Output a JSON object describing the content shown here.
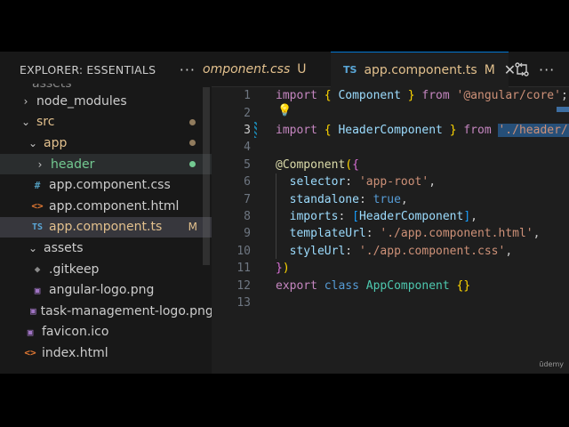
{
  "sidebar": {
    "title": "EXPLORER: ESSENTIALS",
    "more_icon": "ellipsis-icon",
    "cut_item": "assets",
    "items": [
      {
        "label": "node_modules"
      },
      {
        "label": "src"
      },
      {
        "label": "app"
      },
      {
        "label": "header"
      },
      {
        "label": "app.component.css",
        "icon": "#"
      },
      {
        "label": "app.component.html",
        "icon": "<>"
      },
      {
        "label": "app.component.ts",
        "icon": "TS",
        "badge": "M"
      },
      {
        "label": "assets"
      },
      {
        "label": ".gitkeep"
      },
      {
        "label": "angular-logo.png"
      },
      {
        "label": "task-management-logo.png"
      },
      {
        "label": "favicon.ico"
      },
      {
        "label": "index.html",
        "icon": "<>"
      }
    ]
  },
  "tabs": [
    {
      "label": "omponent.css",
      "status": "U"
    },
    {
      "label": "app.component.ts",
      "icon": "TS",
      "status": "M",
      "close": "✕"
    }
  ],
  "editor": {
    "lines": [
      [
        "1",
        "2",
        "3",
        "4",
        "5",
        "6",
        "7",
        "8",
        "9",
        "10",
        "11",
        "12",
        "13"
      ]
    ],
    "tokens": {
      "import": "import",
      "from": "from",
      "export": "export",
      "class": "class",
      "component": "Component",
      "core": "'@angular/core'",
      "header_component": "HeaderComponent",
      "header_path": "'./header/h",
      "decorator": "@Component",
      "selector_key": "selector",
      "selector_val": "'app-root'",
      "standalone_key": "standalone",
      "standalone_val": "true",
      "imports_key": "imports",
      "template_key": "templateUrl",
      "template_val": "'./app.component.html'",
      "style_key": "styleUrl",
      "style_val": "'./app.component.css'",
      "app_component": "AppComponent"
    }
  },
  "watermark": "ūdemy",
  "colors": {
    "modified": "#e2c08d",
    "untracked": "#73c991",
    "accent": "#0078d4"
  }
}
